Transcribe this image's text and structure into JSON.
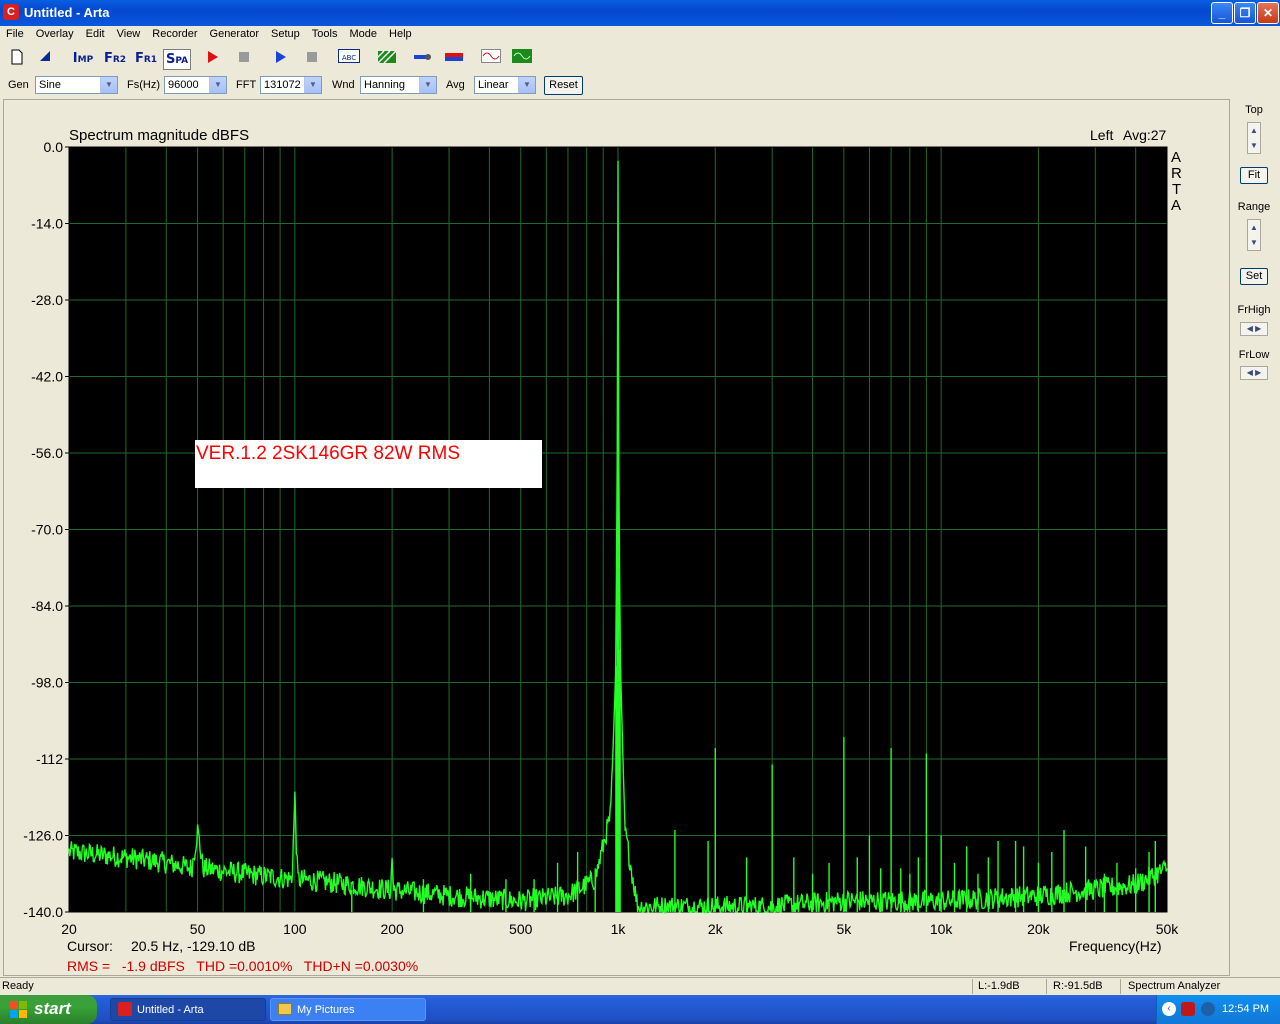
{
  "window": {
    "title": "Untitled - Arta",
    "app_icon_letter": "C"
  },
  "menu": [
    "File",
    "Overlay",
    "Edit",
    "View",
    "Recorder",
    "Generator",
    "Setup",
    "Tools",
    "Mode",
    "Help"
  ],
  "toolbar": {
    "imp": {
      "big": "I",
      "small": "MP"
    },
    "fr2": {
      "big": "F",
      "small": "R2"
    },
    "fr1": {
      "big": "F",
      "small": "R1"
    },
    "spa": {
      "big": "S",
      "small": "PA"
    },
    "abc": "ABC"
  },
  "controls": {
    "gen_label": "Gen",
    "gen_value": "Sine",
    "fs_label": "Fs(Hz)",
    "fs_value": "96000",
    "fft_label": "FFT",
    "fft_value": "131072",
    "wnd_label": "Wnd",
    "wnd_value": "Hanning",
    "avg_label": "Avg",
    "avg_value": "Linear",
    "reset_label": "Reset"
  },
  "right_panel": {
    "top_label": "Top",
    "fit_label": "Fit",
    "range_label": "Range",
    "set_label": "Set",
    "frhigh_label": "FrHigh",
    "frlow_label": "FrLow"
  },
  "plot": {
    "cursor_label": "Cursor:",
    "cursor_value": "20.5 Hz, -129.10 dB",
    "rms_line": "RMS =   -1.9 dBFS   THD =0.0010%   THD+N =0.0030%",
    "arta_brand": [
      "A",
      "R",
      "T",
      "A"
    ],
    "annotation": "VER.1.2 2SK146GR 82W RMS",
    "colors": {
      "background": "#000000",
      "grid": "#1f6b2a",
      "trace": "#22ff22",
      "annotation_text": "#ff0000",
      "summary_text": "#cc0000"
    }
  },
  "chart_data": {
    "type": "line",
    "title": "Spectrum magnitude dBFS",
    "channel": "Left",
    "avg": "Avg:27",
    "xlabel": "Frequency(Hz)",
    "ylabel": "",
    "x_scale": "log",
    "xlim": [
      20,
      50000
    ],
    "ylim": [
      -140,
      0
    ],
    "grid": true,
    "x_ticks": [
      {
        "value": 20,
        "label": "20"
      },
      {
        "value": 50,
        "label": "50"
      },
      {
        "value": 100,
        "label": "100"
      },
      {
        "value": 200,
        "label": "200"
      },
      {
        "value": 500,
        "label": "500"
      },
      {
        "value": 1000,
        "label": "1k"
      },
      {
        "value": 2000,
        "label": "2k"
      },
      {
        "value": 5000,
        "label": "5k"
      },
      {
        "value": 10000,
        "label": "10k"
      },
      {
        "value": 20000,
        "label": "20k"
      },
      {
        "value": 50000,
        "label": "50k"
      }
    ],
    "y_ticks": [
      0,
      -14,
      -28,
      -42,
      -56,
      -70,
      -84,
      -98,
      -112,
      -126,
      -140
    ],
    "y_tick_labels": [
      "0.0",
      "-14.0",
      "-28.0",
      "-42.0",
      "-56.0",
      "-70.0",
      "-84.0",
      "-98.0",
      "-112",
      "-126.0",
      "-140.0"
    ],
    "series": [
      {
        "x": [
          20,
          30,
          40,
          48,
          50,
          52,
          70,
          98,
          100,
          102,
          150,
          198,
          200,
          202,
          300,
          500,
          700,
          850,
          950,
          985,
          995,
          1000,
          1005,
          1015,
          1050,
          1150,
          1300,
          2000,
          3000,
          5000,
          10000,
          20000,
          40000,
          50000
        ],
        "y": [
          -129,
          -130,
          -131,
          -132,
          -125,
          -132,
          -133,
          -134,
          -119,
          -134,
          -135,
          -136,
          -130,
          -136,
          -137,
          -138,
          -137,
          -134,
          -122,
          -95,
          -55,
          -2.5,
          -55,
          -92,
          -125,
          -139,
          -139,
          -139,
          -139,
          -138,
          -138,
          -137,
          -135,
          -132
        ]
      }
    ],
    "spurs": [
      {
        "x": 150,
        "y": -136
      },
      {
        "x": 250,
        "y": -134
      },
      {
        "x": 350,
        "y": -133
      },
      {
        "x": 450,
        "y": -134
      },
      {
        "x": 550,
        "y": -134
      },
      {
        "x": 650,
        "y": -131
      },
      {
        "x": 750,
        "y": -129
      },
      {
        "x": 850,
        "y": -132
      },
      {
        "x": 1500,
        "y": -125
      },
      {
        "x": 1900,
        "y": -127
      },
      {
        "x": 2000,
        "y": -110
      },
      {
        "x": 2500,
        "y": -130
      },
      {
        "x": 3000,
        "y": -113
      },
      {
        "x": 3500,
        "y": -130
      },
      {
        "x": 4000,
        "y": -133
      },
      {
        "x": 4500,
        "y": -131
      },
      {
        "x": 5000,
        "y": -108
      },
      {
        "x": 5500,
        "y": -130
      },
      {
        "x": 6000,
        "y": -126
      },
      {
        "x": 6500,
        "y": -132
      },
      {
        "x": 7000,
        "y": -110
      },
      {
        "x": 7500,
        "y": -132
      },
      {
        "x": 8000,
        "y": -133
      },
      {
        "x": 8500,
        "y": -130
      },
      {
        "x": 9000,
        "y": -111
      },
      {
        "x": 10000,
        "y": -126
      },
      {
        "x": 11000,
        "y": -131
      },
      {
        "x": 12000,
        "y": -128
      },
      {
        "x": 13000,
        "y": -133
      },
      {
        "x": 14000,
        "y": -130
      },
      {
        "x": 15000,
        "y": -127
      },
      {
        "x": 17000,
        "y": -127
      },
      {
        "x": 18000,
        "y": -128
      },
      {
        "x": 20000,
        "y": -131
      },
      {
        "x": 22000,
        "y": -129
      },
      {
        "x": 24000,
        "y": -125
      },
      {
        "x": 28000,
        "y": -128
      },
      {
        "x": 32000,
        "y": -133
      },
      {
        "x": 35000,
        "y": -131
      },
      {
        "x": 40000,
        "y": -132
      },
      {
        "x": 44000,
        "y": -129
      },
      {
        "x": 46000,
        "y": -127
      }
    ]
  },
  "statusbar": {
    "ready": "Ready",
    "left_level": "L:-1.9dB",
    "right_level": "R:-91.5dB",
    "mode": "Spectrum Analyzer"
  },
  "taskbar": {
    "start_label": "start",
    "tasks": [
      "Untitled - Arta",
      "My Pictures"
    ],
    "clock": "12:54 PM"
  }
}
